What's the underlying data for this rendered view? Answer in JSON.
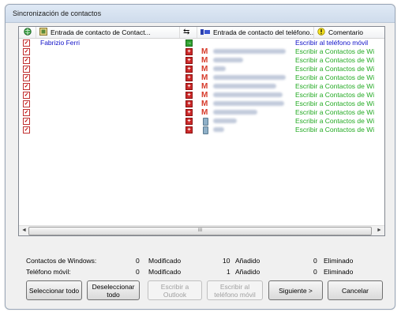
{
  "window": {
    "title": "Sincronización de contactos"
  },
  "columns": [
    {
      "icon": "globe-icon",
      "label": ""
    },
    {
      "icon": "windows-contact-icon",
      "label": "Entrada de contacto de Contact..."
    },
    {
      "icon": "sync-action-icon",
      "label": ""
    },
    {
      "icon": "phone-contact-icon",
      "label": "Entrada de contacto del teléfono..."
    },
    {
      "icon": "warning-icon",
      "label": "Comentario"
    }
  ],
  "rows": [
    {
      "checked": true,
      "name": "Fabrizio Ferri",
      "action": "arrow",
      "source": "",
      "comment": "Escribir al teléfono móvil",
      "comment_color": "blue"
    },
    {
      "checked": true,
      "name": "",
      "action": "add",
      "source": "gmail",
      "comment": "Escribir a Contactos de Wi",
      "comment_color": "green"
    },
    {
      "checked": true,
      "name": "",
      "action": "add",
      "source": "gmail",
      "comment": "Escribir a Contactos de Wi",
      "comment_color": "green"
    },
    {
      "checked": true,
      "name": "",
      "action": "add",
      "source": "gmail",
      "comment": "Escribir a Contactos de Wi",
      "comment_color": "green"
    },
    {
      "checked": true,
      "name": "",
      "action": "add",
      "source": "gmail",
      "comment": "Escribir a Contactos de Wi",
      "comment_color": "green"
    },
    {
      "checked": true,
      "name": "",
      "action": "add",
      "source": "gmail",
      "comment": "Escribir a Contactos de Wi",
      "comment_color": "green"
    },
    {
      "checked": true,
      "name": "",
      "action": "add",
      "source": "gmail",
      "comment": "Escribir a Contactos de Wi",
      "comment_color": "green"
    },
    {
      "checked": true,
      "name": "",
      "action": "add",
      "source": "gmail",
      "comment": "Escribir a Contactos de Wi",
      "comment_color": "green"
    },
    {
      "checked": true,
      "name": "",
      "action": "add",
      "source": "gmail",
      "comment": "Escribir a Contactos de Wi",
      "comment_color": "green"
    },
    {
      "checked": true,
      "name": "",
      "action": "add",
      "source": "phone",
      "comment": "Escribir a Contactos de Wi",
      "comment_color": "green"
    },
    {
      "checked": true,
      "name": "",
      "action": "add",
      "source": "phone",
      "comment": "Escribir a Contactos de Wi",
      "comment_color": "green"
    }
  ],
  "scrollbar": {
    "thumb_label": "III"
  },
  "stats": {
    "windows": {
      "label": "Contactos de Windows:",
      "modified_count": "0",
      "modified_label": "Modificado",
      "added_count": "10",
      "added_label": "Añadido",
      "deleted_count": "0",
      "deleted_label": "Eliminado"
    },
    "phone": {
      "label": "Teléfono móvil:",
      "modified_count": "0",
      "modified_label": "Modificado",
      "added_count": "1",
      "added_label": "Añadido",
      "deleted_count": "0",
      "deleted_label": "Eliminado"
    }
  },
  "buttons": {
    "select_all": "Seleccionar todo",
    "deselect_all": "Deseleccionar todo",
    "write_outlook": "Escribir a Outlook",
    "write_phone": "Escribir al teléfono móvil",
    "next": "Siguiente >",
    "cancel": "Cancelar"
  },
  "colors": {
    "comment_green": "#22aa22",
    "comment_blue": "#1010c8",
    "name_blue": "#1010c8"
  }
}
